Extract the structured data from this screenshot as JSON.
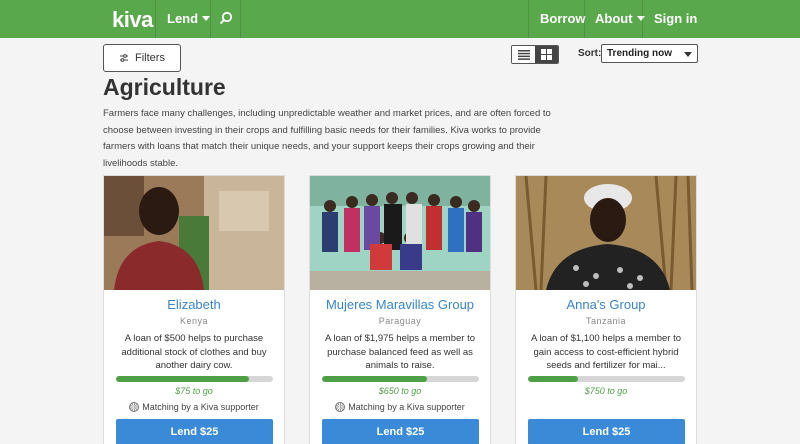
{
  "nav": {
    "logo": "kiva",
    "lend_label": "Lend",
    "search_icon": "search-icon",
    "borrow_label": "Borrow",
    "about_label": "About",
    "signin_label": "Sign in",
    "color": "#5aa84c"
  },
  "toolbar": {
    "filters_label": "Filters",
    "filters_icon": "sliders-icon",
    "view_list_icon": "list-view-icon",
    "view_grid_icon": "grid-view-icon",
    "active_view": "grid",
    "sort_label": "Sort:",
    "sort_value": "Trending now"
  },
  "category": {
    "title": "Agriculture",
    "description": "Farmers face many challenges, including unpredictable weather and market prices, and are often forced to choose between investing in their crops and fulfilling basic needs for their families. Kiva works to provide farmers with loans that match their unique needs, and your support keeps their crops growing and their livelihoods stable."
  },
  "loans": [
    {
      "name": "Elizabeth",
      "country": "Kenya",
      "description": "A loan of $500 helps to purchase additional stock of clothes and buy another dairy cow.",
      "funded_fraction": 0.85,
      "to_go": "$75 to go",
      "matching": "Matching by a Kiva supporter",
      "lend_label": "Lend $25"
    },
    {
      "name": "Mujeres Maravillas Group",
      "country": "Paraguay",
      "description": "A loan of $1,975 helps a member to purchase balanced feed as well as animals to raise.",
      "funded_fraction": 0.67,
      "to_go": "$650 to go",
      "matching": "Matching by a Kiva supporter",
      "lend_label": "Lend $25"
    },
    {
      "name": "Anna's Group",
      "country": "Tanzania",
      "description": "A loan of $1,100 helps a member to gain access to cost-efficient hybrid seeds and fertilizer for mai...",
      "funded_fraction": 0.32,
      "to_go": "$750 to go",
      "matching": "",
      "lend_label": "Lend $25"
    }
  ],
  "colors": {
    "accent_green": "#4f9f46",
    "link_blue": "#3a84c6",
    "button_blue": "#3a8ad8"
  }
}
